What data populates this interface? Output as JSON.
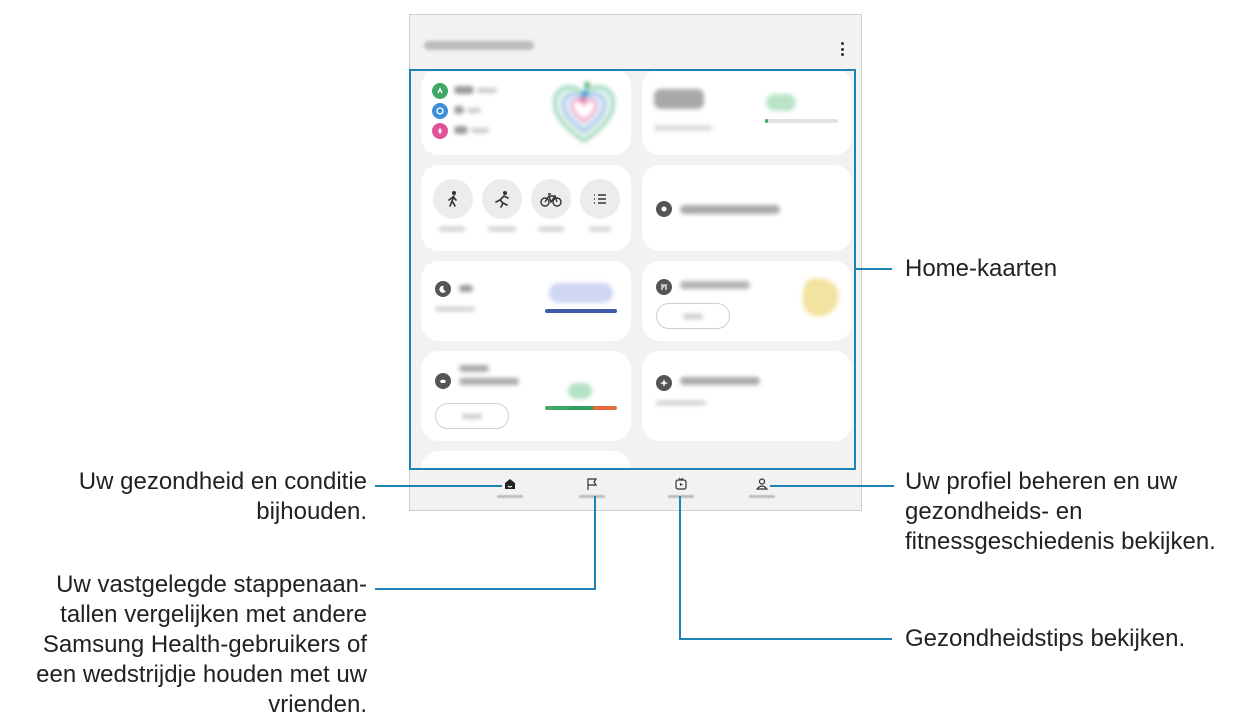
{
  "callouts": {
    "home_cards": "Home-kaarten",
    "track_health": [
      "Uw gezondheid en conditie",
      "bijhouden."
    ],
    "compare_steps": [
      "Uw vastgelegde stappenaan-",
      "tallen vergelijken met andere",
      "Samsung Health-gebruikers of",
      "een wedstrijdje houden met uw",
      "vrienden."
    ],
    "manage_profile": [
      "Uw profiel beheren en uw",
      "gezondheids- en",
      "fitnessgeschiedenis bekijken."
    ],
    "health_tips": "Gezondheidstips bekijken."
  },
  "colors": {
    "callout_line": "#1e82b4",
    "green": "#3ea864",
    "blue": "#3d8fd8",
    "pink": "#e0559a",
    "navy": "#3f5aa8",
    "orange": "#e46b3b",
    "yellow": "#f3e3a0"
  },
  "icons": [
    "more-options-icon",
    "walking-icon",
    "running-icon",
    "cycling-icon",
    "list-icon",
    "home-icon",
    "flag-icon",
    "play-icon",
    "person-icon"
  ]
}
